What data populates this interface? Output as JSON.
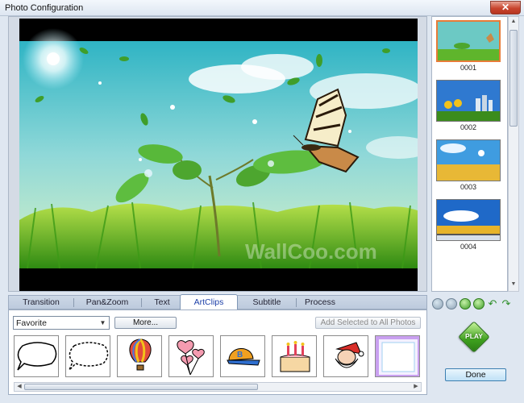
{
  "window": {
    "title": "Photo Configuration",
    "close_label": "✕"
  },
  "thumbnails": [
    {
      "label": "0001",
      "selected": true
    },
    {
      "label": "0002",
      "selected": false
    },
    {
      "label": "0003",
      "selected": false
    },
    {
      "label": "0004",
      "selected": false
    }
  ],
  "preview": {
    "watermark": "WallCoo.com"
  },
  "tabs": [
    {
      "label": "Transition",
      "active": false
    },
    {
      "label": "Pan&Zoom",
      "active": false
    },
    {
      "label": "Text",
      "active": false
    },
    {
      "label": "ArtClips",
      "active": true
    },
    {
      "label": "Subtitle",
      "active": false
    },
    {
      "label": "Process",
      "active": false
    }
  ],
  "artclips": {
    "category_value": "Favorite",
    "more_label": "More...",
    "add_all_label": "Add Selected to All Photos",
    "clips": [
      "speech-bubble",
      "dashed-speech-bubble",
      "hot-air-balloon",
      "heart-balloons",
      "baseball-cap",
      "birthday-cake",
      "santa-claus",
      "frame-border"
    ]
  },
  "play_label": "PLAY",
  "done_label": "Done",
  "colors": {
    "accent": "#e87c38",
    "play_green": "#3ea01e"
  }
}
